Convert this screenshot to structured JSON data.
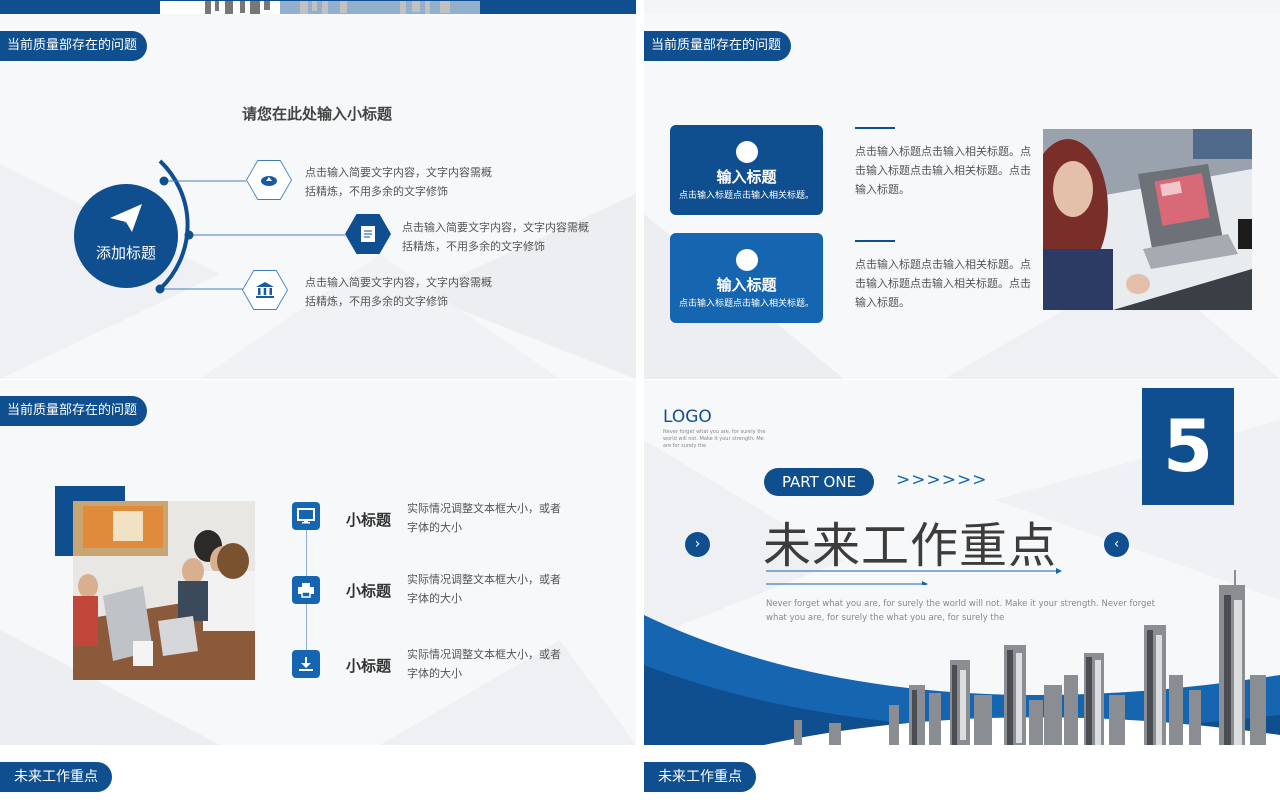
{
  "colors": {
    "primary": "#0f4f8f",
    "accent": "#1a6fbf",
    "text": "#444444"
  },
  "slide1": {
    "tag": "当前质量部存在的问题",
    "subtitle": "请您在此处输入小标题",
    "center_label": "添加标题",
    "items": [
      {
        "icon": "cloud-upload-icon",
        "line1": "点击输入简要文字内容，文字内容需概",
        "line2": "括精炼，不用多余的文字修饰"
      },
      {
        "icon": "document-icon",
        "line1": "点击输入简要文字内容，文字内容需概",
        "line2": "括精炼，不用多余的文字修饰"
      },
      {
        "icon": "bank-icon",
        "line1": "点击输入简要文字内容，文字内容需概",
        "line2": "括精炼，不用多余的文字修饰"
      }
    ]
  },
  "slide2": {
    "tag": "当前质量部存在的问题",
    "cards": [
      {
        "title": "输入标题",
        "sub": "点击输入标题点击输入相关标题。"
      },
      {
        "title": "输入标题",
        "sub": "点击输入标题点击输入相关标题。"
      }
    ],
    "paras": [
      {
        "l1": "点击输入标题点击输入相关标题。点",
        "l2": "击输入标题点击输入相关标题。点击",
        "l3": "输入标题。"
      },
      {
        "l1": "点击输入标题点击输入相关标题。点",
        "l2": "击输入标题点击输入相关标题。点击",
        "l3": "输入标题。"
      }
    ]
  },
  "slide3": {
    "tag": "当前质量部存在的问题",
    "items": [
      {
        "icon": "monitor-icon",
        "title": "小标题",
        "l1": "实际情况调整文本框大小，或者",
        "l2": "字体的大小"
      },
      {
        "icon": "printer-icon",
        "title": "小标题",
        "l1": "实际情况调整文本框大小，或者",
        "l2": "字体的大小"
      },
      {
        "icon": "download-icon",
        "title": "小标题",
        "l1": "实际情况调整文本框大小，或者",
        "l2": "字体的大小"
      }
    ]
  },
  "slide4": {
    "logo": "LOGO",
    "logo_tag1": "Never forget what you are, for surely the",
    "logo_tag2": "world will not. Make it your strength. Me",
    "logo_tag3": "are for surely the",
    "number": "5",
    "part": "PART ONE",
    "arrows": ">>>>>>",
    "title": "未来工作重点",
    "desc1": "Never forget what you are, for surely the world will not. Make it your strength. Never forget",
    "desc2": "what you are, for surely the what you are, for surely the"
  },
  "slide5": {
    "tag": "未来工作重点"
  },
  "slide6": {
    "tag": "未来工作重点"
  }
}
